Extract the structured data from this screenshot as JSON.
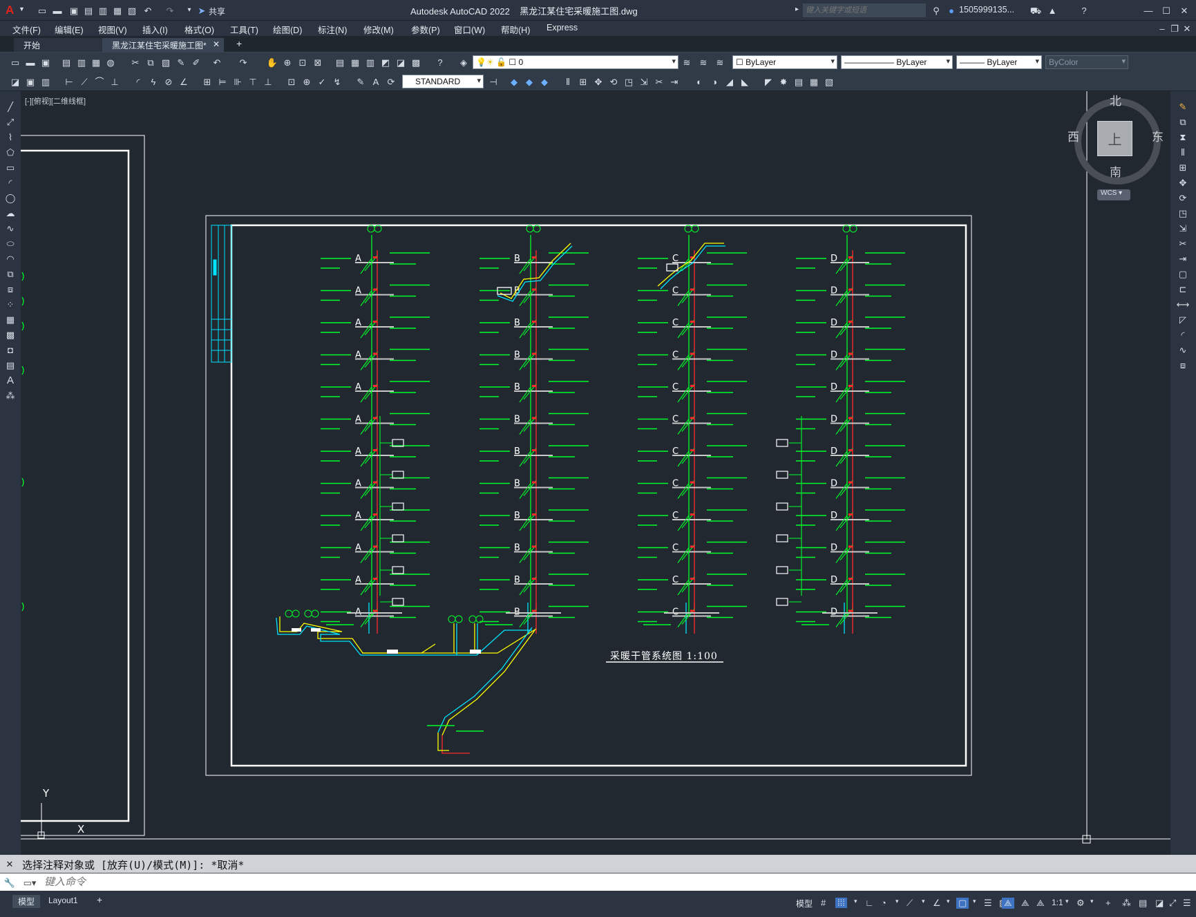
{
  "titlebar": {
    "app_title": "Autodesk AutoCAD 2022",
    "file_name": "黑龙江某住宅采暖施工图.dwg",
    "share_label": "共享",
    "search_placeholder": "键入关键字或短语",
    "user_name": "1505999135...",
    "icons": [
      "autocad-logo-icon",
      "new-icon",
      "open-icon",
      "save-icon",
      "saveas-icon",
      "plot-icon",
      "undo-icon",
      "redo-icon",
      "share-icon",
      "search-icon",
      "user-icon",
      "cart-icon",
      "autodesk-icon",
      "help-icon",
      "minimize-icon",
      "restore-icon",
      "close-icon"
    ]
  },
  "menu": {
    "items": [
      "文件(F)",
      "编辑(E)",
      "视图(V)",
      "插入(I)",
      "格式(O)",
      "工具(T)",
      "绘图(D)",
      "标注(N)",
      "修改(M)",
      "参数(P)",
      "窗口(W)",
      "帮助(H)",
      "Express"
    ]
  },
  "tabs": {
    "start": "开始",
    "active": "黑龙江某住宅采暖施工图*",
    "add": "+"
  },
  "layers": {
    "current_layer": "0",
    "color": "ByLayer",
    "linetype": "ByLayer",
    "lineweight": "ByLayer",
    "plotstyle": "ByColor",
    "text_style": "STANDARD"
  },
  "viewport": {
    "label": "[-][俯视][二维线框]",
    "compass_n": "北",
    "compass_s": "南",
    "compass_e": "东",
    "compass_w": "西",
    "compass_center": "上",
    "wcs": "WCS",
    "ucs_x": "X",
    "ucs_y": "Y"
  },
  "drawing": {
    "title": "采暖干管系统图 1:100",
    "riser_labels": [
      "A",
      "B",
      "C",
      "D"
    ]
  },
  "command": {
    "history": "选择注释对象或 [放弃(U)/模式(M)]: *取消*",
    "placeholder": "键入命令"
  },
  "status": {
    "tabs": [
      "模型",
      "Layout1",
      "+"
    ],
    "model": "模型",
    "scale": "1:1"
  },
  "colors": {
    "background": "#212830",
    "pipe_green": "#00ff2a",
    "pipe_red": "#ff2a2a",
    "pipe_cyan": "#00e5ff",
    "pipe_yellow": "#ffff00",
    "frame": "#ffffff"
  }
}
